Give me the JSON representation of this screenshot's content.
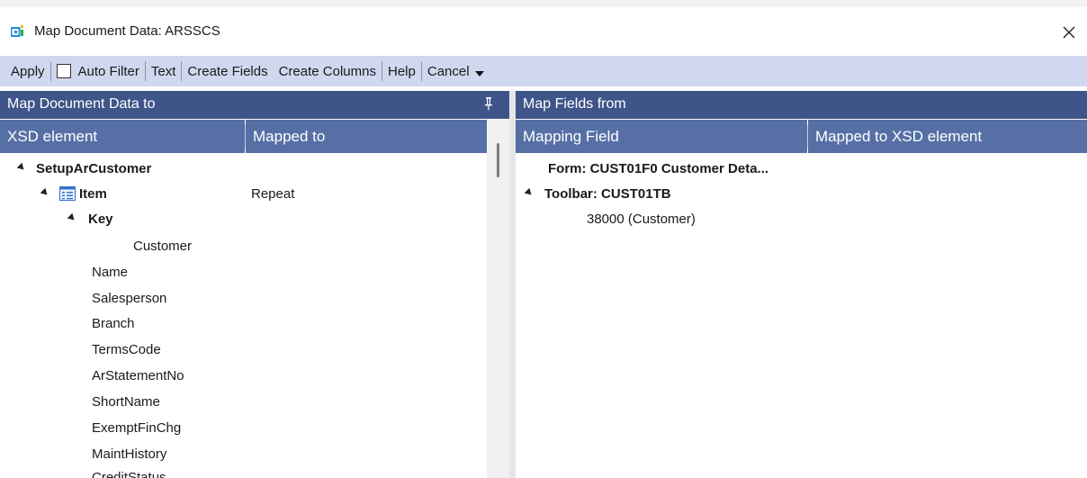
{
  "window": {
    "title": "Map Document Data: ARSSCS",
    "close_glyph": "✕"
  },
  "toolbar": {
    "apply": "Apply",
    "auto_filter": "Auto Filter",
    "auto_filter_checked": false,
    "text": "Text",
    "create_fields": "Create Fields",
    "create_columns": "Create Columns",
    "help": "Help",
    "cancel": "Cancel"
  },
  "left_pane": {
    "title": "Map Document Data to",
    "columns": [
      "XSD element",
      "Mapped to"
    ],
    "tree": [
      {
        "label": "SetupArCustomer",
        "bold": true,
        "expanded": true,
        "mapped": ""
      },
      {
        "label": "Item",
        "bold": true,
        "expanded": true,
        "icon": "table-icon",
        "mapped": "Repeat"
      },
      {
        "label": "Key",
        "bold": true,
        "expanded": true,
        "mapped": ""
      },
      {
        "label": "Customer",
        "bold": false,
        "mapped": ""
      },
      {
        "label": "Name",
        "bold": false,
        "mapped": ""
      },
      {
        "label": "Salesperson",
        "bold": false,
        "mapped": ""
      },
      {
        "label": "Branch",
        "bold": false,
        "mapped": ""
      },
      {
        "label": "TermsCode",
        "bold": false,
        "mapped": ""
      },
      {
        "label": "ArStatementNo",
        "bold": false,
        "mapped": ""
      },
      {
        "label": "ShortName",
        "bold": false,
        "mapped": ""
      },
      {
        "label": "ExemptFinChg",
        "bold": false,
        "mapped": ""
      },
      {
        "label": "MaintHistory",
        "bold": false,
        "mapped": ""
      },
      {
        "label": "CreditStatus",
        "bold": false,
        "mapped": ""
      }
    ]
  },
  "right_pane": {
    "title": "Map Fields from",
    "columns": [
      "Mapping Field",
      "Mapped to XSD element"
    ],
    "tree": [
      {
        "label": "Form: CUST01F0 Customer Deta...",
        "bold": true
      },
      {
        "label": "Toolbar: CUST01TB",
        "bold": true,
        "expanded": true
      },
      {
        "label": "38000 (Customer)",
        "bold": false
      }
    ]
  },
  "colors": {
    "toolbar_bg": "#cfd8ee",
    "pane_header_bg": "#3f5589",
    "column_header_bg": "#5670a6"
  }
}
